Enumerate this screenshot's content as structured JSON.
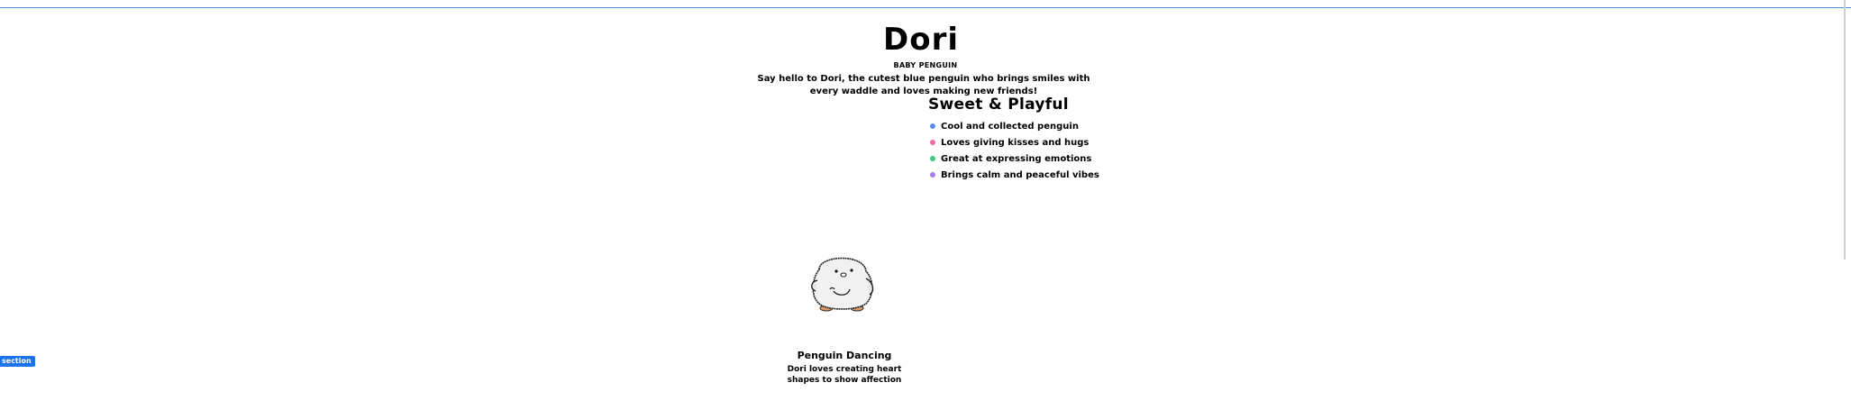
{
  "hero": {
    "title": "Dori",
    "subtitle": "BABY PENGUIN",
    "intro": "Say hello to Dori, the cutest blue penguin who brings smiles with every waddle and loves making new friends!"
  },
  "features": {
    "title": "Sweet & Playful",
    "items": [
      {
        "label": "Cool and collected penguin",
        "dot_color": "#5b8def"
      },
      {
        "label": "Loves giving kisses and hugs",
        "dot_color": "#f06aa0"
      },
      {
        "label": "Great at expressing emotions",
        "dot_color": "#3cc97a"
      },
      {
        "label": "Brings calm and peaceful vibes",
        "dot_color": "#a77be6"
      }
    ]
  },
  "gallery": {
    "image_icon": "penguin-illustration",
    "caption_title": "Penguin Dancing",
    "caption_text": "Dori loves creating heart shapes to show affection"
  },
  "section_badge": {
    "label": "section",
    "color": "#1a73e8"
  }
}
